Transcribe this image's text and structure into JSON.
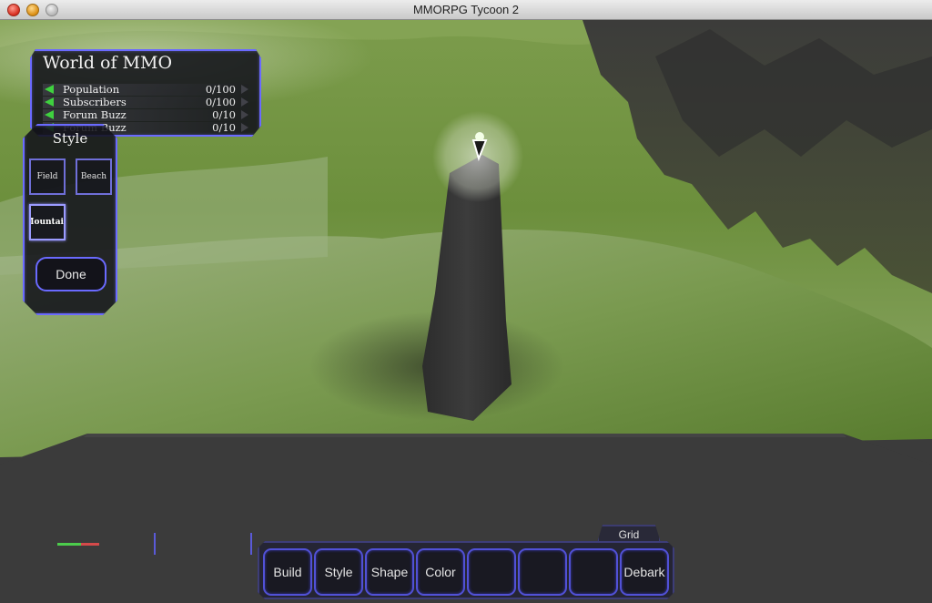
{
  "window": {
    "title": "MMORPG Tycoon 2"
  },
  "stats": {
    "title": "World of MMO",
    "rows": [
      {
        "label": "Population",
        "value": "0/100"
      },
      {
        "label": "Subscribers",
        "value": "0/100"
      },
      {
        "label": "Forum Buzz",
        "value": "0/10"
      },
      {
        "label": "Forum Buzz",
        "value": "0/10"
      }
    ]
  },
  "style_panel": {
    "title": "Style",
    "options": [
      {
        "label": "Field"
      },
      {
        "label": "Beach"
      },
      {
        "label": "Mountain",
        "selected": true
      }
    ],
    "done_label": "Done"
  },
  "toolbar": {
    "grid_label": "Grid",
    "buttons": [
      {
        "label": "Build"
      },
      {
        "label": "Style"
      },
      {
        "label": "Shape"
      },
      {
        "label": "Color"
      },
      {
        "label": ""
      },
      {
        "label": ""
      },
      {
        "label": ""
      },
      {
        "label": "Debark"
      }
    ]
  },
  "colors": {
    "hud_border": "#6a6aff",
    "stat_arrow": "#3fd13f",
    "ground_dark": "#3b3b3b",
    "grass": "#6f9a3c"
  }
}
